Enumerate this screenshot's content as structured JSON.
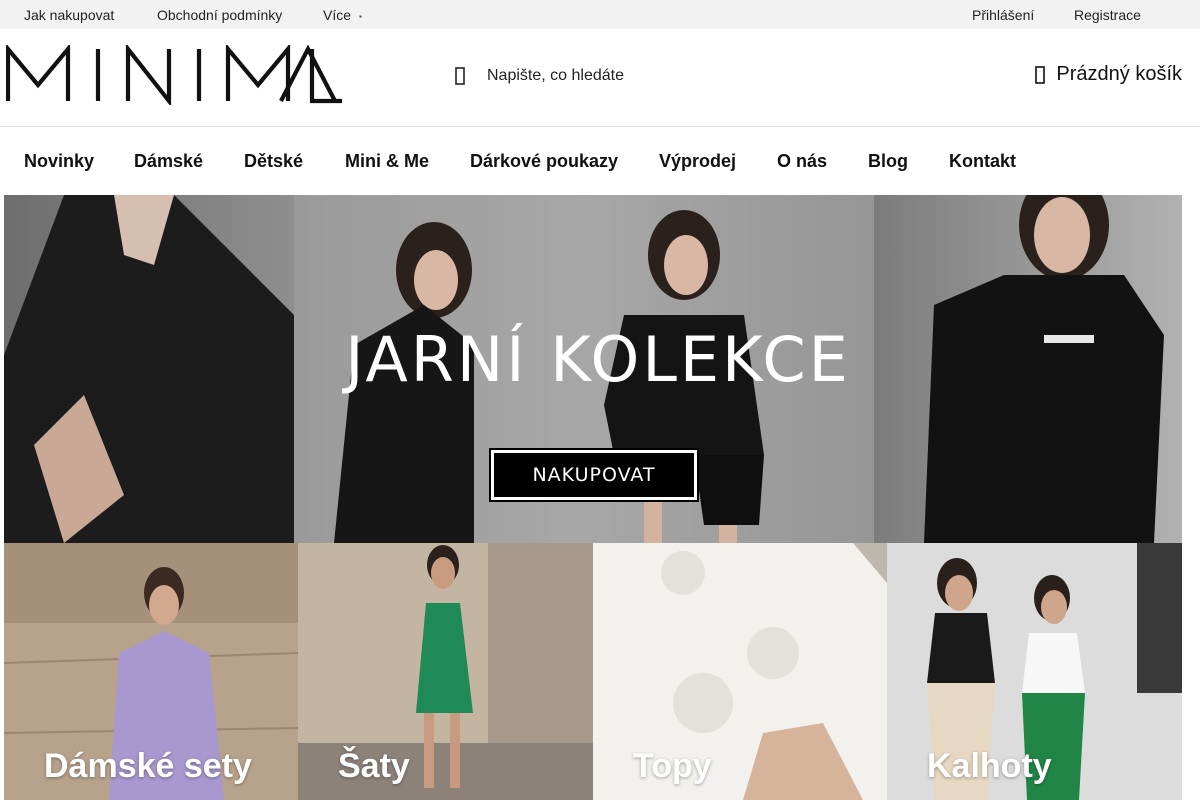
{
  "topbar": {
    "links": [
      "Jak nakupovat",
      "Obchodní podmínky"
    ],
    "more_label": "Více",
    "login_label": "Přihlášení",
    "register_label": "Registrace"
  },
  "header": {
    "logo_text": "MINIMAL",
    "search_placeholder": "Napište, co hledáte",
    "search_icon": "search-icon",
    "cart_label": "Prázdný košík",
    "cart_icon": "cart-icon"
  },
  "nav": {
    "items": [
      "Novinky",
      "Dámské",
      "Dětské",
      "Mini & Me",
      "Dárkové poukazy",
      "Výprodej",
      "O nás",
      "Blog",
      "Kontakt"
    ]
  },
  "hero": {
    "title": "JARNÍ KOLEKCE",
    "button_label": "NAKUPOVAT"
  },
  "categories": [
    {
      "label": "Dámské sety"
    },
    {
      "label": "Šaty"
    },
    {
      "label": "Topy"
    },
    {
      "label": "Kalhoty"
    }
  ]
}
